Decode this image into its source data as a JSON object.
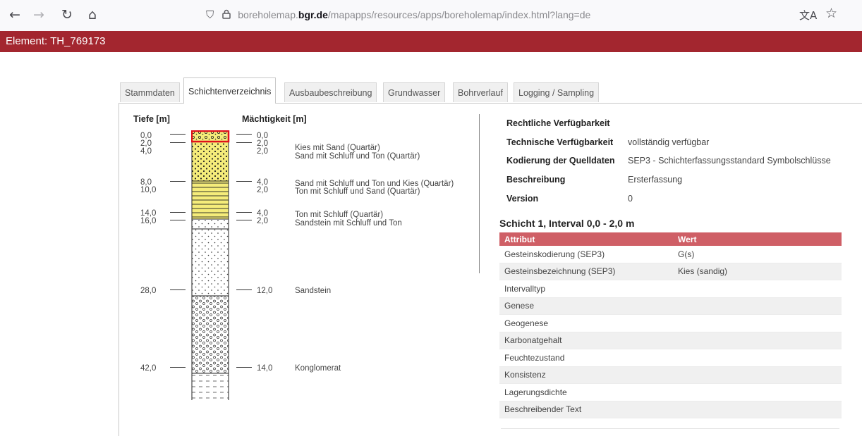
{
  "browser": {
    "url_host": "boreholemap.",
    "url_domain": "bgr.de",
    "url_path": "/mapapps/resources/apps/boreholemap/index.html?lang=de"
  },
  "element_title": "Element: TH_769173",
  "tabs": [
    {
      "label": "Stammdaten",
      "active": false
    },
    {
      "label": "Schichtenverzeichnis",
      "active": true
    },
    {
      "label": "Ausbaubeschreibung",
      "active": false
    },
    {
      "label": "Grundwasser",
      "active": false
    },
    {
      "label": "Bohrverlauf",
      "active": false
    },
    {
      "label": "Logging / Sampling",
      "active": false
    }
  ],
  "profile": {
    "depth_header": "Tiefe [m]",
    "thickness_header": "Mächtigkeit [m]",
    "depths": [
      "0,0",
      "2,0",
      "4,0",
      "8,0",
      "10,0",
      "14,0",
      "16,0",
      "28,0",
      "42,0"
    ],
    "thicknesses": [
      "0,0",
      "2,0",
      "2,0",
      "4,0",
      "2,0",
      "4,0",
      "2,0",
      "12,0",
      "14,0"
    ],
    "descriptions": [
      "",
      "Kies mit Sand (Quartär)",
      "Sand mit Schluff und Ton (Quartär)",
      "Sand mit Schluff und Ton und Kies (Quartär)",
      "Ton mit Schluff und Sand (Quartär)",
      "Ton mit Schluff (Quartär)",
      "Sandstein mit Schluff und Ton",
      "Sandstein",
      "Konglomerat"
    ]
  },
  "info": [
    {
      "key": "Rechtliche Verfügbarkeit",
      "value": ""
    },
    {
      "key": "Technische Verfügbarkeit",
      "value": "vollständig verfügbar"
    },
    {
      "key": "Kodierung der Quelldaten",
      "value": "SEP3 - Schichterfassungsstandard Symbolschlüsse"
    },
    {
      "key": "Beschreibung",
      "value": "Ersterfassung"
    },
    {
      "key": "Version",
      "value": "0"
    }
  ],
  "layer_title": "Schicht 1, Interval 0,0 - 2,0 m",
  "attr_table": {
    "headers": [
      "Attribut",
      "Wert"
    ],
    "rows": [
      [
        "Gesteinskodierung (SEP3)",
        "G(s)"
      ],
      [
        "Gesteinsbezeichnung (SEP3)",
        "Kies (sandig)"
      ],
      [
        "Intervalltyp",
        ""
      ],
      [
        "Genese",
        ""
      ],
      [
        "Geogenese",
        ""
      ],
      [
        "Karbonatgehalt",
        ""
      ],
      [
        "Feuchtezustand",
        ""
      ],
      [
        "Konsistenz",
        ""
      ],
      [
        "Lagerungsdichte",
        ""
      ],
      [
        "Beschreibender Text",
        ""
      ]
    ]
  },
  "colors": {
    "title_bar": "#a3262f",
    "table_header": "#cf5f66",
    "quaternary_fill": "#f5ec7a",
    "selected_outline": "#e0101a"
  }
}
